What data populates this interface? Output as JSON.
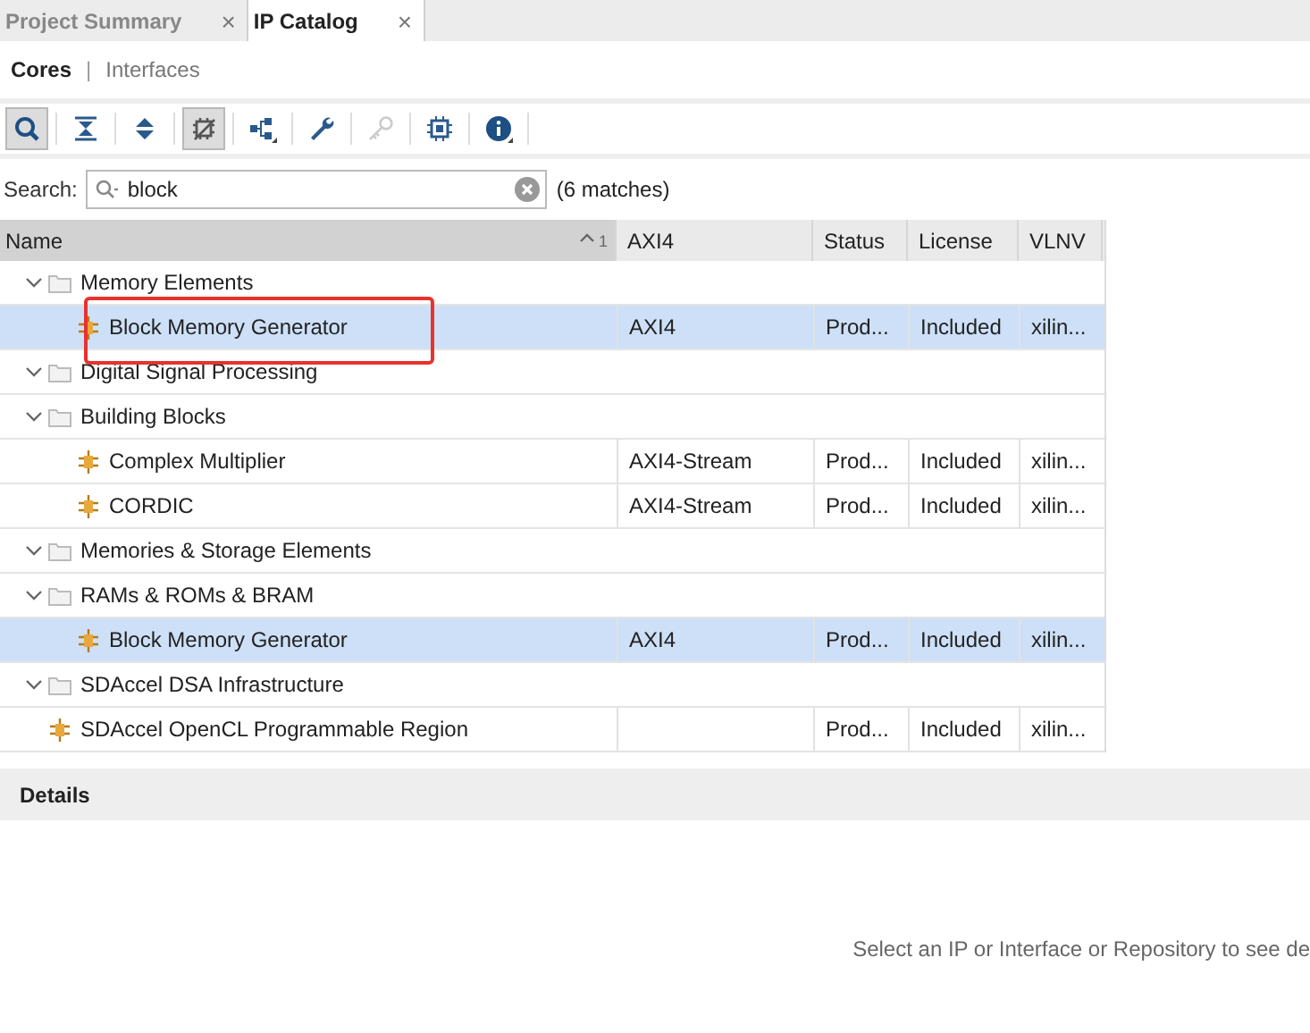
{
  "tabs": [
    {
      "label": "Project Summary",
      "selected": false,
      "close": "×"
    },
    {
      "label": "IP Catalog",
      "selected": true,
      "close": "×"
    }
  ],
  "view_switch": [
    {
      "label": "Cores",
      "selected": true
    },
    {
      "label": "Interfaces",
      "selected": false
    }
  ],
  "view_separator": "|",
  "toolbar": [
    {
      "kind": "search",
      "pressed": true,
      "disabled": false
    },
    {
      "kind": "collapse",
      "pressed": false,
      "disabled": false
    },
    {
      "kind": "expand",
      "pressed": false,
      "disabled": false
    },
    {
      "kind": "filter",
      "pressed": true,
      "disabled": false
    },
    {
      "kind": "hierarchy",
      "pressed": false,
      "disabled": false
    },
    {
      "kind": "wrench",
      "pressed": false,
      "disabled": false
    },
    {
      "kind": "key",
      "pressed": false,
      "disabled": true
    },
    {
      "kind": "chip",
      "pressed": false,
      "disabled": false
    },
    {
      "kind": "info",
      "pressed": false,
      "disabled": false
    }
  ],
  "search": {
    "label": "Search:",
    "value": "block",
    "matches": "(6 matches)"
  },
  "table": {
    "columns": [
      {
        "label": "Name",
        "sort": "1"
      },
      {
        "label": "AXI4"
      },
      {
        "label": "Status"
      },
      {
        "label": "License"
      },
      {
        "label": "VLNV"
      }
    ],
    "tree": [
      {
        "children": [
          {
            "kind": "group",
            "name": "Memory Elements",
            "expanded": true,
            "children": [
              {
                "kind": "ip",
                "name": "Block Memory Generator",
                "selected": true,
                "marked": true,
                "cells": [
                  "AXI4",
                  "Prod...",
                  "Included",
                  "xilin..."
                ]
              }
            ]
          }
        ]
      },
      {
        "kind": "group",
        "name": "Digital Signal Processing",
        "expanded": true,
        "children": [
          {
            "kind": "group",
            "name": "Building Blocks",
            "expanded": true,
            "children": [
              {
                "kind": "ip",
                "name": "Complex Multiplier",
                "selected": false,
                "marked": false,
                "cells": [
                  "AXI4-Stream",
                  "Prod...",
                  "Included",
                  "xilin..."
                ]
              },
              {
                "kind": "ip",
                "name": "CORDIC",
                "selected": false,
                "marked": false,
                "cells": [
                  "AXI4-Stream",
                  "Prod...",
                  "Included",
                  "xilin..."
                ]
              }
            ]
          }
        ]
      },
      {
        "kind": "group",
        "name": "Memories & Storage Elements",
        "expanded": true,
        "children": [
          {
            "kind": "group",
            "name": "RAMs & ROMs & BRAM",
            "expanded": true,
            "children": [
              {
                "kind": "ip",
                "name": "Block Memory Generator",
                "selected": true,
                "marked": false,
                "cells": [
                  "AXI4",
                  "Prod...",
                  "Included",
                  "xilin..."
                ]
              }
            ]
          }
        ]
      },
      {
        "kind": "group",
        "name": "SDAccel DSA Infrastructure",
        "expanded": true,
        "children": [
          {
            "kind": "ip",
            "name": "SDAccel OpenCL Programmable Region",
            "selected": false,
            "marked": false,
            "cells": [
              "",
              "Prod...",
              "Included",
              "xilin..."
            ]
          }
        ]
      }
    ]
  },
  "details": {
    "title": "Details",
    "message": "Select an IP or Interface or Repository to see de"
  }
}
